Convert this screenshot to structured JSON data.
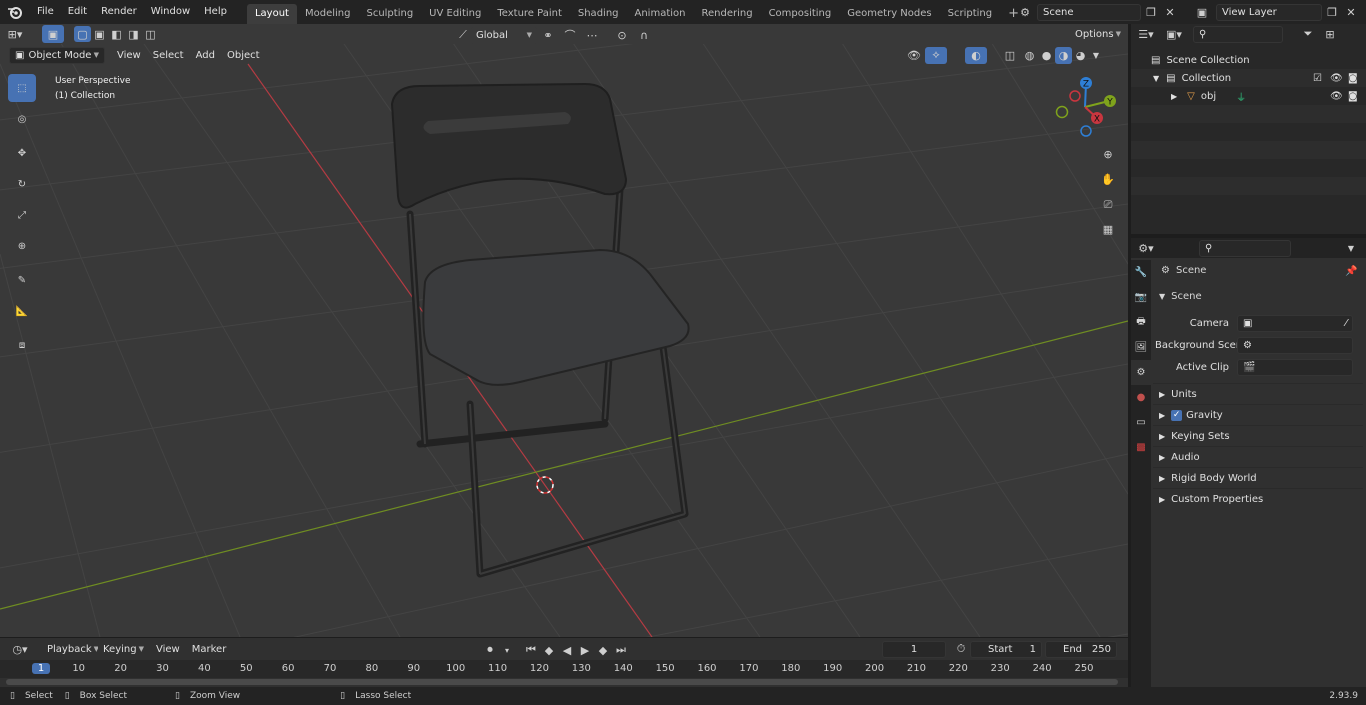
{
  "menu": {
    "file": "File",
    "edit": "Edit",
    "render": "Render",
    "window": "Window",
    "help": "Help"
  },
  "workspaces": [
    "Layout",
    "Modeling",
    "Sculpting",
    "UV Editing",
    "Texture Paint",
    "Shading",
    "Animation",
    "Rendering",
    "Compositing",
    "Geometry Nodes",
    "Scripting"
  ],
  "scene_name": "Scene",
  "view_layer": "View Layer",
  "toolbar": {
    "transform_orientation": "Global",
    "options": "Options"
  },
  "viewport": {
    "mode": "Object Mode",
    "view": "View",
    "select": "Select",
    "add": "Add",
    "object": "Object",
    "perspective": "User Perspective",
    "collection_label": "(1) Collection",
    "gizmo": {
      "x": "X",
      "y": "Y",
      "z": "Z"
    }
  },
  "outliner": {
    "scene_collection": "Scene Collection",
    "collection": "Collection",
    "object": "obj"
  },
  "properties": {
    "context": "Scene",
    "panel_scene": "Scene",
    "camera_label": "Camera",
    "background_scene_label": "Background Scene",
    "active_clip_label": "Active Clip",
    "panels": [
      "Units",
      "Gravity",
      "Keying Sets",
      "Audio",
      "Rigid Body World",
      "Custom Properties"
    ]
  },
  "timeline": {
    "playback": "Playback",
    "keying": "Keying",
    "view": "View",
    "marker": "Marker",
    "current_frame": "1",
    "start_label": "Start",
    "start": "1",
    "end_label": "End",
    "end": "250",
    "ticks": [
      "1",
      "10",
      "20",
      "30",
      "40",
      "50",
      "60",
      "70",
      "80",
      "90",
      "100",
      "110",
      "120",
      "130",
      "140",
      "150",
      "160",
      "170",
      "180",
      "190",
      "200",
      "210",
      "220",
      "230",
      "240",
      "250"
    ]
  },
  "status": {
    "select": "Select",
    "box_select": "Box Select",
    "zoom_view": "Zoom View",
    "lasso_select": "Lasso Select",
    "version": "2.93.9"
  },
  "colors": {
    "accent": "#4772b3",
    "x_axis": "#c9363f",
    "y_axis": "#7fa31c",
    "z_axis": "#2e7fd6",
    "background": "#393939"
  }
}
